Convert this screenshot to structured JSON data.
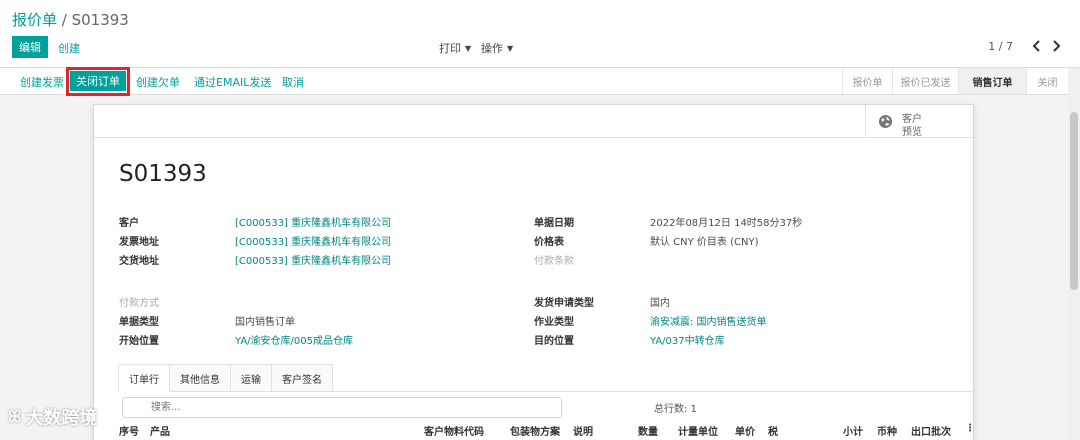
{
  "breadcrumb": {
    "parent": "报价单",
    "separator": " / ",
    "current": "S01393"
  },
  "toolbar": {
    "edit_label": "编辑",
    "create_label": "创建",
    "print_label": "打印",
    "action_label": "操作"
  },
  "pager": {
    "value": "1 / 7"
  },
  "statusbar": {
    "buttons": [
      "创建发票",
      "关闭订单",
      "创建欠单",
      "通过EMAIL发送",
      "取消"
    ],
    "stages": [
      {
        "label": "报价单",
        "active": false
      },
      {
        "label": "报价已发送",
        "active": false
      },
      {
        "label": "销售订单",
        "active": true
      },
      {
        "label": "关闭",
        "active": false
      }
    ]
  },
  "preview": {
    "line1": "客户",
    "line2": "预览"
  },
  "form": {
    "name": "S01393",
    "left_group1": [
      {
        "label": "客户",
        "value": "[C000533] 重庆隆鑫机车有限公司"
      },
      {
        "label": "发票地址",
        "value": "[C000533] 重庆隆鑫机车有限公司"
      },
      {
        "label": "交货地址",
        "value": "[C000533] 重庆隆鑫机车有限公司"
      }
    ],
    "right_group1": [
      {
        "label": "单据日期",
        "value": "2022年08月12日 14时58分37秒"
      },
      {
        "label": "价格表",
        "value": "默认 CNY 价目表 (CNY)"
      },
      {
        "label": "付款条款",
        "value": ""
      }
    ],
    "left_group2": [
      {
        "label": "付款方式",
        "value": ""
      },
      {
        "label": "单据类型",
        "value": "国内销售订单"
      },
      {
        "label": "开始位置",
        "value": "YA/渝安仓库/005成品仓库"
      }
    ],
    "right_group2": [
      {
        "label": "发货申请类型",
        "value": "国内"
      },
      {
        "label": "作业类型",
        "value": "渝安减震: 国内销售送货单"
      },
      {
        "label": "目的位置",
        "value": "YA/037中转仓库"
      }
    ]
  },
  "tabs": [
    "订单行",
    "其他信息",
    "运输",
    "客户签名"
  ],
  "lines": {
    "search_placeholder": "搜索...",
    "total": "总行数: 1",
    "columns": [
      "序号",
      "产品",
      "客户物料代码",
      "包装物方案",
      "说明",
      "数量",
      "计量单位",
      "单价",
      "税",
      "小计",
      "币种",
      "出口批次"
    ]
  },
  "watermark": "大数跨境"
}
